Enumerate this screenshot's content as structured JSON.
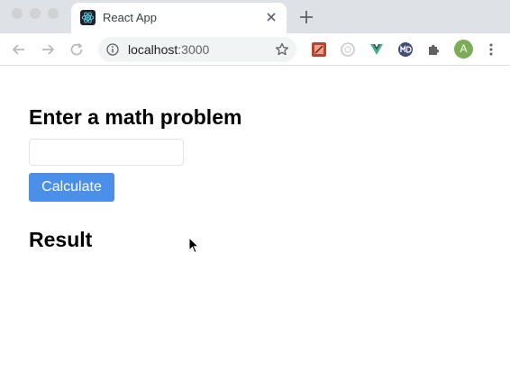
{
  "browser": {
    "tab": {
      "title": "React App",
      "favicon": "react-logo-icon"
    },
    "address_bar": {
      "host": "localhost",
      "port": ":3000"
    },
    "avatar_initial": "A",
    "colors": {
      "tabstrip": "#dee1e6",
      "avatar": "#7cac55"
    }
  },
  "page": {
    "heading": "Enter a math problem",
    "input": {
      "value": "",
      "placeholder": ""
    },
    "calculate_label": "Calculate",
    "result_heading": "Result",
    "colors": {
      "button": "#4a90e9"
    }
  }
}
